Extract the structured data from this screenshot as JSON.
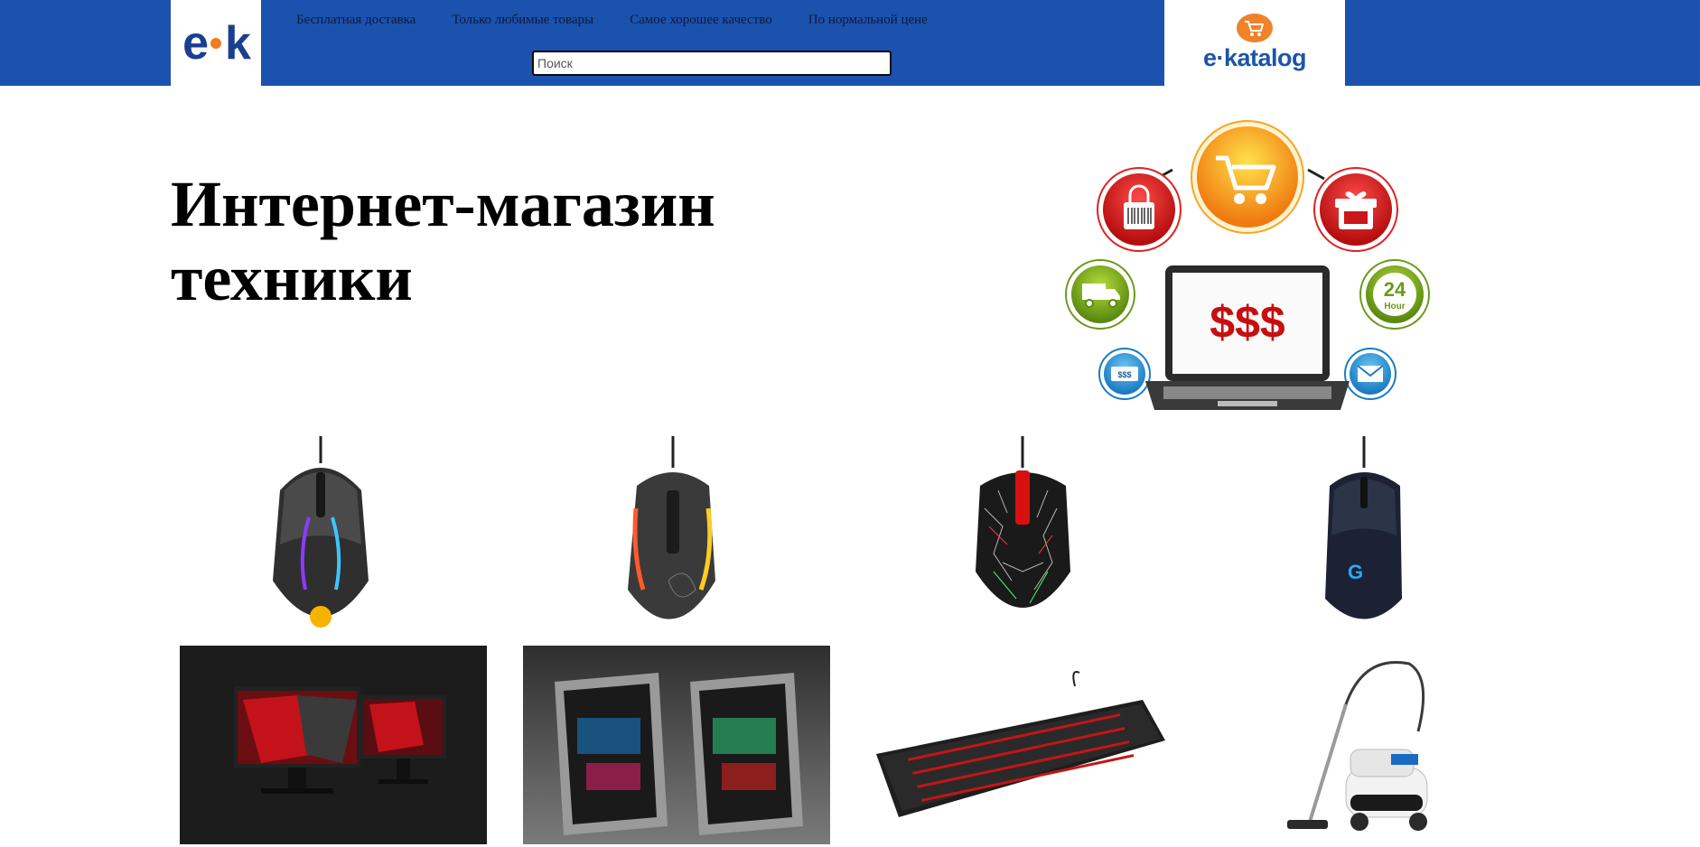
{
  "header": {
    "nav": [
      "Бесплатная доставка",
      "Только любимые товары",
      "Самое хорошее качество",
      "По нормальной цене"
    ],
    "search_placeholder": "Поиск",
    "logo_small_text": "ek",
    "logo_big_text": "e·katalog"
  },
  "hero": {
    "title_line1": "Интернет-магазин",
    "title_line2": "техники",
    "graphic_price": "$$$",
    "graphic_24": "24",
    "graphic_hour": "Hour",
    "graphic_bill": "$$$"
  },
  "colors": {
    "header_bg": "#1b52ae",
    "logo_dot": "#f47a20"
  },
  "products": [
    {
      "name": "gaming-mouse-steelseries"
    },
    {
      "name": "gaming-mouse-roccat"
    },
    {
      "name": "gaming-mouse-bloody"
    },
    {
      "name": "gaming-mouse-logitech"
    },
    {
      "name": "dual-monitors"
    },
    {
      "name": "gaming-pc-cases"
    },
    {
      "name": "mechanical-keyboard"
    },
    {
      "name": "vacuum-cleaner"
    }
  ]
}
